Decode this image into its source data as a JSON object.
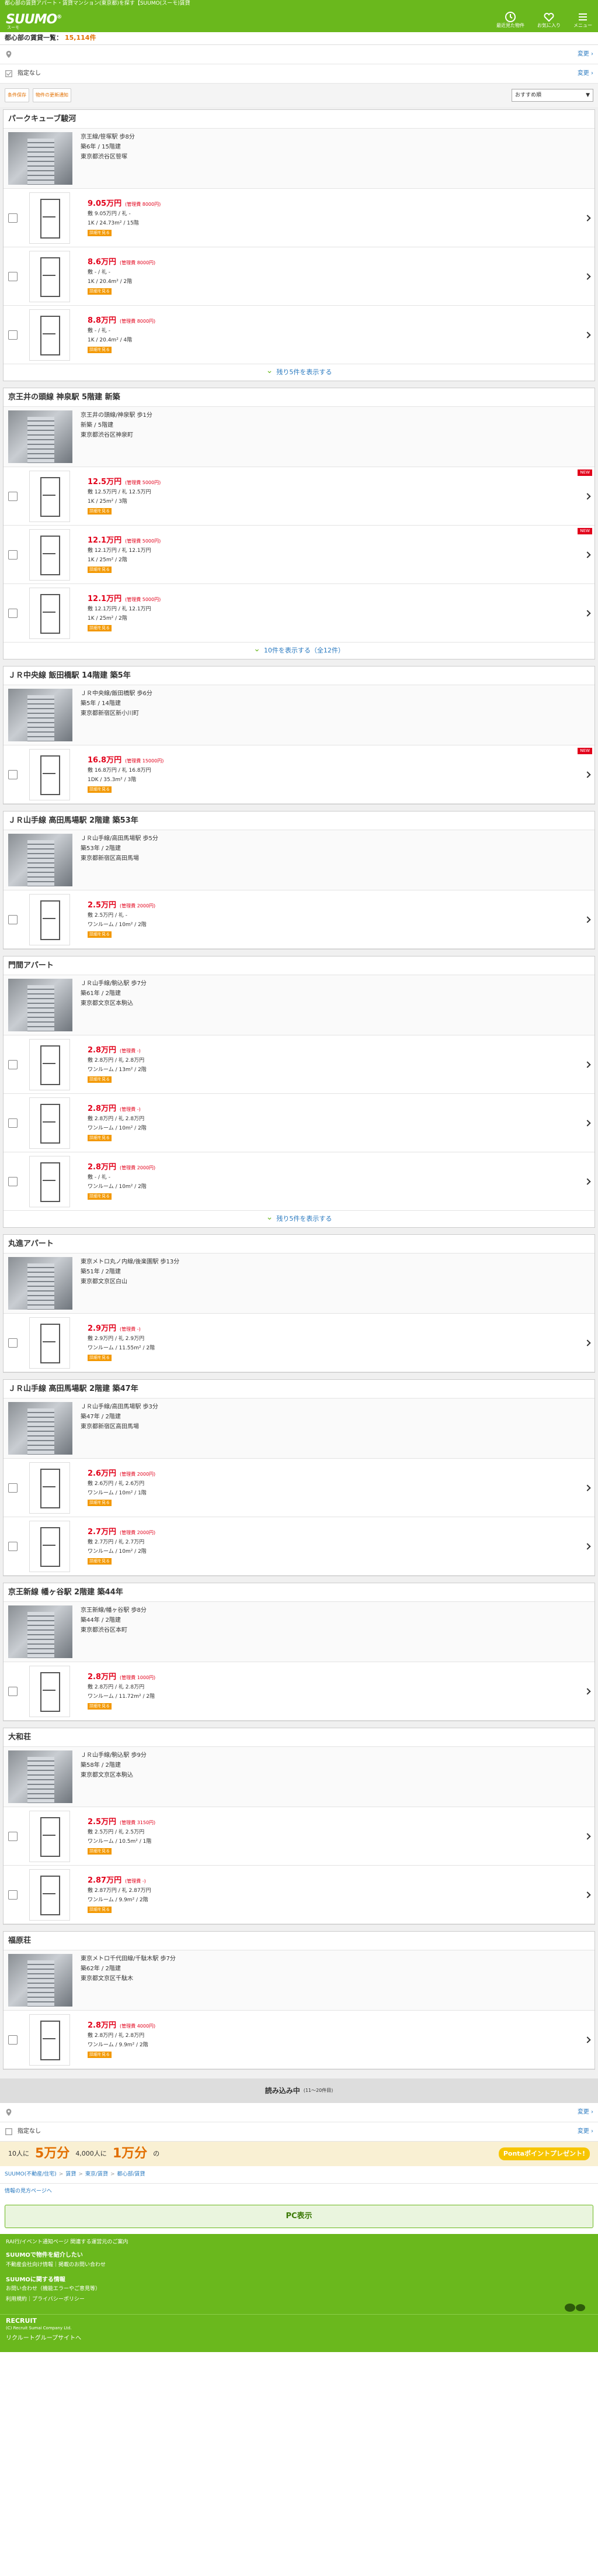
{
  "topline": "都心部の賃貸アパート・賃貸マンション(東京都)を探す【SUUMO(スーモ)賃貸",
  "header": {
    "logo": "SUUMO",
    "logo_sub": "スーモ",
    "icons": [
      {
        "name": "history-icon",
        "label": "最近見た物件"
      },
      {
        "name": "favorite-icon",
        "label": "お気に入り"
      },
      {
        "name": "menu-icon",
        "label": "メニュー"
      }
    ]
  },
  "count": {
    "label": "都心部の賃貸一覧",
    "value": "15,114件"
  },
  "cond_area": {
    "label": "",
    "change": "変更"
  },
  "cond_filter": {
    "label": "指定なし",
    "change": "変更"
  },
  "toolbar": {
    "b1": "条件保存",
    "b2": "物件の更新通知",
    "sort": "おすすめ順"
  },
  "properties": [
    {
      "title": "パークキューブ駿河",
      "addr": [
        "京王線/笹塚駅 歩8分",
        "築6年 / 15階建",
        "東京都渋谷区笹塚"
      ],
      "rooms": [
        {
          "rent": "9.05万円",
          "fee": "(管理費 8000円)",
          "deposit": "敷 9.05万円 / 礼 -",
          "layout": "1K / 24.73m² / 15階",
          "btn": "詳細を見る",
          "new": ""
        },
        {
          "rent": "8.6万円",
          "fee": "(管理費 8000円)",
          "deposit": "敷 - / 礼 -",
          "layout": "1K / 20.4m² / 2階",
          "btn": "詳細を見る",
          "new": ""
        },
        {
          "rent": "8.8万円",
          "fee": "(管理費 8000円)",
          "deposit": "敷 - / 礼 -",
          "layout": "1K / 20.4m² / 4階",
          "btn": "詳細を見る",
          "new": ""
        }
      ],
      "more": "残り5件を表示する"
    },
    {
      "title": "京王井の頭線 神泉駅 5階建 新築",
      "addr": [
        "京王井の頭線/神泉駅 歩1分",
        "新築 / 5階建",
        "東京都渋谷区神泉町"
      ],
      "rooms": [
        {
          "rent": "12.5万円",
          "fee": "(管理費 5000円)",
          "deposit": "敷 12.5万円 / 礼 12.5万円",
          "layout": "1K / 25m² / 3階",
          "btn": "詳細を見る",
          "new": "NEW"
        },
        {
          "rent": "12.1万円",
          "fee": "(管理費 5000円)",
          "deposit": "敷 12.1万円 / 礼 12.1万円",
          "layout": "1K / 25m² / 2階",
          "btn": "詳細を見る",
          "new": "NEW"
        },
        {
          "rent": "12.1万円",
          "fee": "(管理費 5000円)",
          "deposit": "敷 12.1万円 / 礼 12.1万円",
          "layout": "1K / 25m² / 2階",
          "btn": "詳細を見る",
          "new": ""
        }
      ],
      "more": "10件を表示する（全12件）"
    },
    {
      "title": "ＪＲ中央線 飯田橋駅 14階建 築5年",
      "addr": [
        "ＪＲ中央線/飯田橋駅 歩6分",
        "築5年 / 14階建",
        "東京都新宿区新小川町"
      ],
      "rooms": [
        {
          "rent": "16.8万円",
          "fee": "(管理費 15000円)",
          "deposit": "敷 16.8万円 / 礼 16.8万円",
          "layout": "1DK / 35.3m² / 3階",
          "btn": "詳細を見る",
          "new": "NEW"
        }
      ],
      "more": ""
    },
    {
      "title": "ＪＲ山手線 高田馬場駅 2階建 築53年",
      "addr": [
        "ＪＲ山手線/高田馬場駅 歩5分",
        "築53年 / 2階建",
        "東京都新宿区高田馬場"
      ],
      "rooms": [
        {
          "rent": "2.5万円",
          "fee": "(管理費 2000円)",
          "deposit": "敷 2.5万円 / 礼 -",
          "layout": "ワンルーム / 10m² / 2階",
          "btn": "詳細を見る",
          "new": ""
        }
      ],
      "more": ""
    },
    {
      "title": "門間アパート",
      "addr": [
        "ＪＲ山手線/駒込駅 歩7分",
        "築61年 / 2階建",
        "東京都文京区本駒込"
      ],
      "rooms": [
        {
          "rent": "2.8万円",
          "fee": "(管理費 -)",
          "deposit": "敷 2.8万円 / 礼 2.8万円",
          "layout": "ワンルーム / 13m² / 2階",
          "btn": "詳細を見る",
          "new": ""
        },
        {
          "rent": "2.8万円",
          "fee": "(管理費 -)",
          "deposit": "敷 2.8万円 / 礼 2.8万円",
          "layout": "ワンルーム / 10m² / 2階",
          "btn": "詳細を見る",
          "new": ""
        },
        {
          "rent": "2.8万円",
          "fee": "(管理費 2000円)",
          "deposit": "敷 - / 礼 -",
          "layout": "ワンルーム / 10m² / 2階",
          "btn": "詳細を見る",
          "new": ""
        }
      ],
      "more": "残り5件を表示する"
    },
    {
      "title": "丸進アパート",
      "addr": [
        "東京メトロ丸ノ内線/後楽園駅 歩13分",
        "築51年 / 2階建",
        "東京都文京区白山"
      ],
      "rooms": [
        {
          "rent": "2.9万円",
          "fee": "(管理費 -)",
          "deposit": "敷 2.9万円 / 礼 2.9万円",
          "layout": "ワンルーム / 11.55m² / 2階",
          "btn": "詳細を見る",
          "new": ""
        }
      ],
      "more": ""
    },
    {
      "title": "ＪＲ山手線 高田馬場駅 2階建 築47年",
      "addr": [
        "ＪＲ山手線/高田馬場駅 歩3分",
        "築47年 / 2階建",
        "東京都新宿区高田馬場"
      ],
      "rooms": [
        {
          "rent": "2.6万円",
          "fee": "(管理費 2000円)",
          "deposit": "敷 2.6万円 / 礼 2.6万円",
          "layout": "ワンルーム / 10m² / 1階",
          "btn": "詳細を見る",
          "new": ""
        },
        {
          "rent": "2.7万円",
          "fee": "(管理費 2000円)",
          "deposit": "敷 2.7万円 / 礼 2.7万円",
          "layout": "ワンルーム / 10m² / 2階",
          "btn": "詳細を見る",
          "new": ""
        }
      ],
      "more": ""
    },
    {
      "title": "京王新線 幡ヶ谷駅 2階建 築44年",
      "addr": [
        "京王新線/幡ヶ谷駅 歩8分",
        "築44年 / 2階建",
        "東京都渋谷区本町"
      ],
      "rooms": [
        {
          "rent": "2.8万円",
          "fee": "(管理費 1000円)",
          "deposit": "敷 2.8万円 / 礼 2.8万円",
          "layout": "ワンルーム / 11.72m² / 2階",
          "btn": "詳細を見る",
          "new": ""
        }
      ],
      "more": ""
    },
    {
      "title": "大和荘",
      "addr": [
        "ＪＲ山手線/駒込駅 歩9分",
        "築58年 / 2階建",
        "東京都文京区本駒込"
      ],
      "rooms": [
        {
          "rent": "2.5万円",
          "fee": "(管理費 3150円)",
          "deposit": "敷 2.5万円 / 礼 2.5万円",
          "layout": "ワンルーム / 10.5m² / 1階",
          "btn": "詳細を見る",
          "new": ""
        },
        {
          "rent": "2.87万円",
          "fee": "(管理費 -)",
          "deposit": "敷 2.87万円 / 礼 2.87万円",
          "layout": "ワンルーム / 9.9m² / 2階",
          "btn": "詳細を見る",
          "new": ""
        }
      ],
      "more": ""
    },
    {
      "title": "福原荘",
      "addr": [
        "東京メトロ千代田線/千駄木駅 歩7分",
        "築62年 / 2階建",
        "東京都文京区千駄木"
      ],
      "rooms": [
        {
          "rent": "2.8万円",
          "fee": "(管理費 4000円)",
          "deposit": "敷 2.8万円 / 礼 2.8万円",
          "layout": "ワンルーム / 9.9m² / 2階",
          "btn": "詳細を見る",
          "new": ""
        }
      ],
      "more": ""
    }
  ],
  "loading": {
    "label": "読み込み中",
    "sub": "(11〜20件目)"
  },
  "banner": {
    "pre": "10人に",
    "big": "5万分",
    "mid": "4,000人に",
    "big2": "1万分",
    "suf": "の",
    "ponta": "Pontaポイントプレゼント!"
  },
  "crumbs": [
    "SUUMO(不動産/住宅)",
    "賃貸",
    "東京/賃貸",
    "都心部/賃貸"
  ],
  "corp": "情報の見方ページへ",
  "pc": "PC表示",
  "footer": {
    "note": "RAI行/イベント通知ページ 関連する運営元のご案内",
    "s1": "SUUMOで物件を紹介したい",
    "l1": "不動産会社向け情報｜掲載のお問い合わせ",
    "s2": "SUUMOに関する情報",
    "l2": "お問い合わせ（機能エラーやご意見等）",
    "l3": "利用規約｜プライバシーポリシー",
    "recruit": "RECRUIT",
    "copy": "(C) Recruit Sumai Company Ltd.",
    "group": "リクルートグループサイトへ"
  }
}
